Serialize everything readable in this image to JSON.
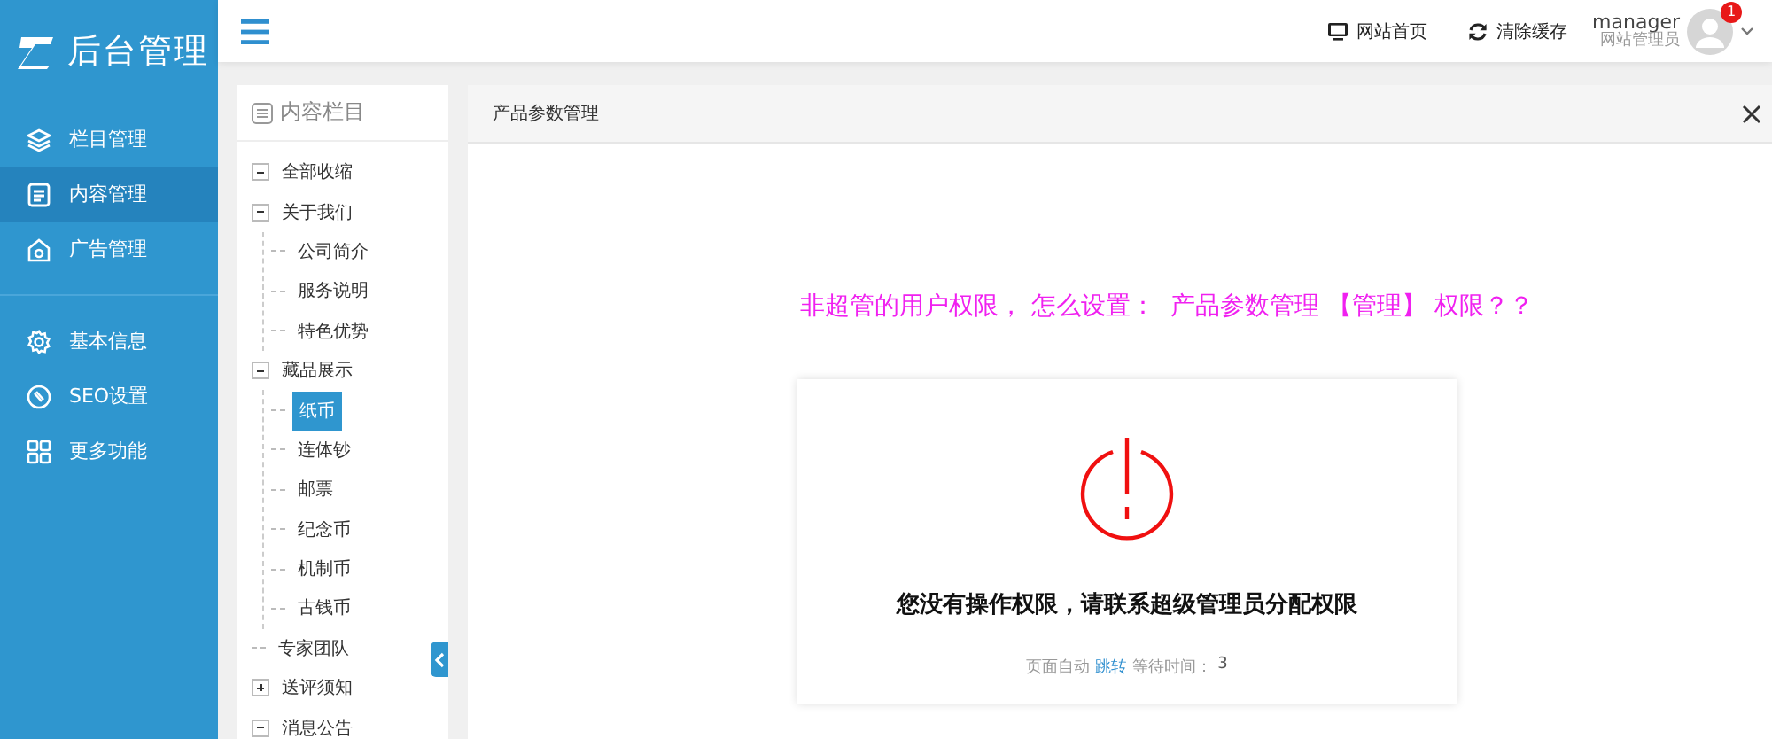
{
  "brand": {
    "title": "后台管理"
  },
  "sidebar": {
    "groups": [
      {
        "items": [
          {
            "label": "栏目管理",
            "selected": false
          },
          {
            "label": "内容管理",
            "selected": true
          },
          {
            "label": "广告管理",
            "selected": false
          }
        ]
      },
      {
        "items": [
          {
            "label": "基本信息",
            "selected": false
          },
          {
            "label": "SEO设置",
            "selected": false
          },
          {
            "label": "更多功能",
            "selected": false
          }
        ]
      }
    ]
  },
  "topbar": {
    "links": [
      {
        "label": "网站首页"
      },
      {
        "label": "清除缓存"
      }
    ],
    "user": {
      "name": "manager",
      "role": "网站管理员",
      "badge": "1"
    }
  },
  "tree_panel": {
    "title": "内容栏目",
    "collapse_all": "全部收缩",
    "items": [
      {
        "label": "关于我们",
        "kind": "folder",
        "expanded": true,
        "selected": false,
        "children": [
          {
            "label": "公司简介",
            "selected": false
          },
          {
            "label": "服务说明",
            "selected": false
          },
          {
            "label": "特色优势",
            "selected": false
          }
        ]
      },
      {
        "label": "藏品展示",
        "kind": "folder",
        "expanded": true,
        "selected": false,
        "children": [
          {
            "label": "纸币",
            "selected": true
          },
          {
            "label": "连体钞",
            "selected": false
          },
          {
            "label": "邮票",
            "selected": false
          },
          {
            "label": "纪念币",
            "selected": false
          },
          {
            "label": "机制币",
            "selected": false
          },
          {
            "label": "古钱币",
            "selected": false
          }
        ]
      },
      {
        "label": "专家团队",
        "kind": "leaf",
        "selected": false
      },
      {
        "label": "送评须知",
        "kind": "folder",
        "expanded": false,
        "selected": false
      },
      {
        "label": "消息公告",
        "kind": "folder",
        "expanded": true,
        "selected": false
      }
    ]
  },
  "tab": {
    "title": "产品参数管理"
  },
  "question": "非超管的用户权限， 怎么设置：  产品参数管理 【管理】 权限？？",
  "notice": {
    "message": "您没有操作权限，请联系超级管理员分配权限",
    "redirect_prefix": "页面自动",
    "redirect_link": "跳转",
    "wait_label": "等待时间：",
    "seconds": "3"
  }
}
